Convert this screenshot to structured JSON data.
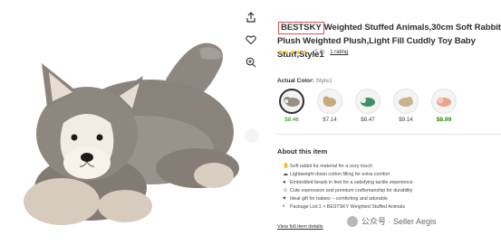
{
  "product": {
    "brand": "BESTSKY",
    "title_rest": "Weighted Stuffed Animals,30cm Soft Rabbit Plush Weighted Plush,Light Fill Cuddly Toy Baby Stuff,Style1",
    "rating_value": "(5.0)",
    "rating_count": "1 rating",
    "stars": "★★★★★"
  },
  "actions": {
    "share_icon": "share-icon",
    "wishlist_icon": "heart-icon",
    "zoom_icon": "zoom-in-icon"
  },
  "color": {
    "label": "Actual Color:",
    "value": "Style1",
    "swatches": [
      {
        "price": "$8.46",
        "selected": true,
        "tone": "#9b8f85"
      },
      {
        "price": "$7.14",
        "selected": false,
        "tone": "#c8a97a"
      },
      {
        "price": "$8.47",
        "selected": false,
        "tone": "#3f8f6a"
      },
      {
        "price": "$9.14",
        "selected": false,
        "tone": "#c9b28e"
      },
      {
        "price": "$8.99",
        "selected": false,
        "sale": true,
        "tone": "#e8a48e"
      }
    ]
  },
  "about": {
    "title": "About this item",
    "features": [
      {
        "icon": "✋",
        "text": "Soft rabbit fur material for a cozy touch"
      },
      {
        "icon": "☁",
        "text": "Lightweight down cotton filling for extra comfort"
      },
      {
        "icon": "●",
        "text": "Embedded beads in feet for a satisfying tactile experience"
      },
      {
        "icon": "☺",
        "text": "Cute expression and premium craftsmanship for durability"
      },
      {
        "icon": "♥",
        "text": "Ideal gift for babies – comforting and adorable"
      },
      {
        "icon": "•",
        "text": "Package List:1 × BESTSKY Weighted Stuffed Animals"
      }
    ],
    "view_all": "View full item details"
  },
  "watermark": {
    "text": "公众号 · Seller Aegis"
  }
}
